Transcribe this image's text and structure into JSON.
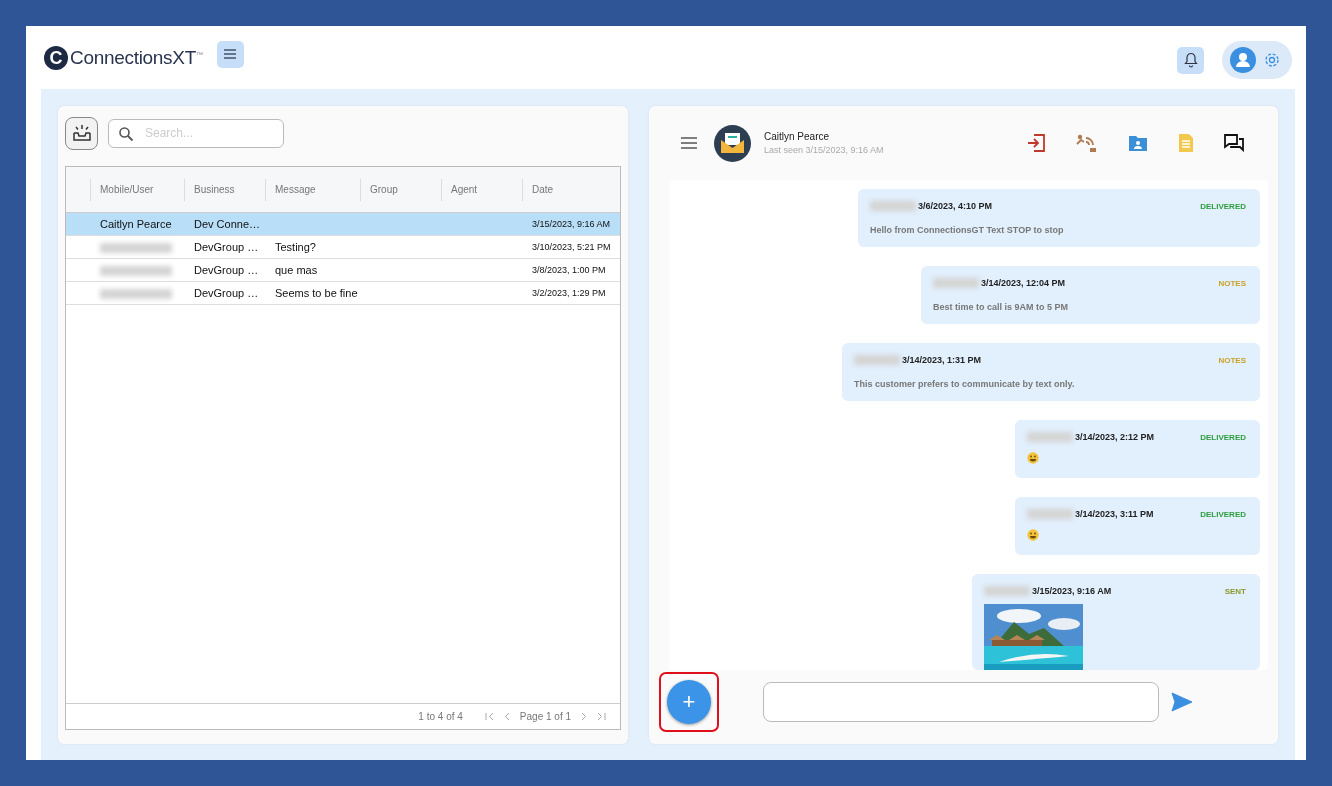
{
  "header": {
    "logo_letter": "C",
    "logo_text": "ConnectionsXT",
    "logo_mark": "™"
  },
  "search": {
    "placeholder": "Search..."
  },
  "table": {
    "columns": [
      "Mobile/User",
      "Business",
      "Message",
      "Group",
      "Agent",
      "Date"
    ],
    "rows": [
      {
        "user": "Caitlyn Pearce",
        "redacted": false,
        "business": "Dev Conne…",
        "message": "",
        "date": "3/15/2023, 9:16 AM",
        "selected": true
      },
      {
        "redacted": true,
        "business": "DevGroup …",
        "message": "Testing?",
        "date": "3/10/2023, 5:21 PM",
        "selected": false
      },
      {
        "redacted": true,
        "business": "DevGroup …",
        "message": "que mas",
        "date": "3/8/2023, 1:00 PM",
        "selected": false
      },
      {
        "redacted": true,
        "business": "DevGroup …",
        "message": "Seems to be fine",
        "date": "3/2/2023, 1:29 PM",
        "selected": false
      }
    ],
    "range": "1 to 4 of 4",
    "page": "Page 1 of 1"
  },
  "chat": {
    "name": "Caitlyn Pearce",
    "last_seen": "Last seen 3/15/2023, 9:16 AM",
    "messages": [
      {
        "time": "3/6/2023, 4:10 PM",
        "status": "DELIVERED",
        "color": "#2e9d3e",
        "kind": "text",
        "text": "Hello from ConnectionsGT Text STOP to stop"
      },
      {
        "time": "3/14/2023, 12:04 PM",
        "status": "NOTES",
        "color": "#c9a227",
        "kind": "text",
        "text": "Best time to call is 9AM to 5 PM"
      },
      {
        "time": "3/14/2023, 1:31 PM",
        "status": "NOTES",
        "color": "#c9a227",
        "kind": "text",
        "text": "This customer prefers to communicate by text only."
      },
      {
        "time": "3/14/2023, 2:12 PM",
        "status": "DELIVERED",
        "color": "#2e9d3e",
        "kind": "emoji"
      },
      {
        "time": "3/14/2023, 3:11 PM",
        "status": "DELIVERED",
        "color": "#2e9d3e",
        "kind": "emoji"
      },
      {
        "time": "3/15/2023, 9:16 AM",
        "status": "SENT",
        "color": "#8a9a2a"
      }
    ],
    "add_button": {
      "label": "+",
      "highlighted": true
    }
  }
}
